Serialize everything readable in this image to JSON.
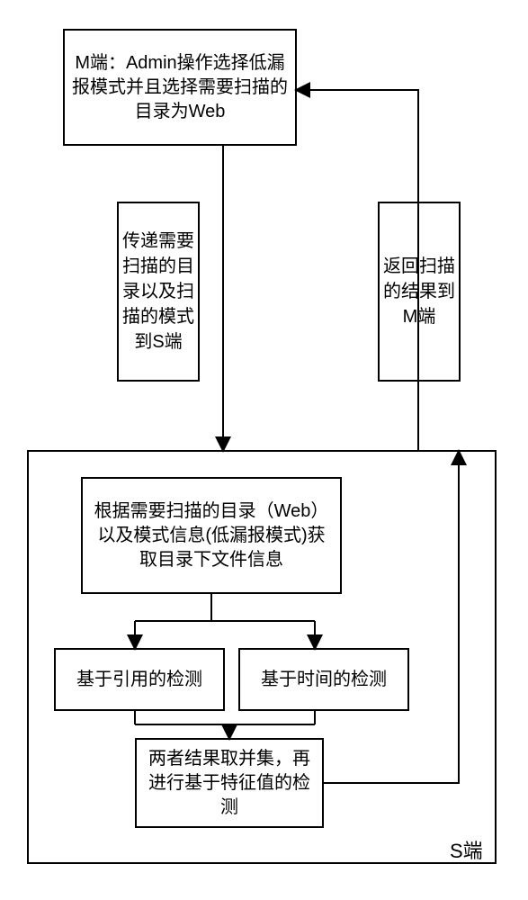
{
  "boxes": {
    "m_admin": "M端：Admin操作选择低漏报模式并且选择需要扫描的目录为Web",
    "pass_to_s": "传递需要扫描的目录以及扫描的模式到S端",
    "return_m": "返回扫描的结果到M端",
    "get_info": "根据需要扫描的目录（Web）以及模式信息(低漏报模式)获取目录下文件信息",
    "detect_ref": "基于引用的检测",
    "detect_time": "基于时间的检测",
    "union": "两者结果取并集，再进行基于特征值的检测"
  },
  "labels": {
    "s_side": "S端"
  }
}
